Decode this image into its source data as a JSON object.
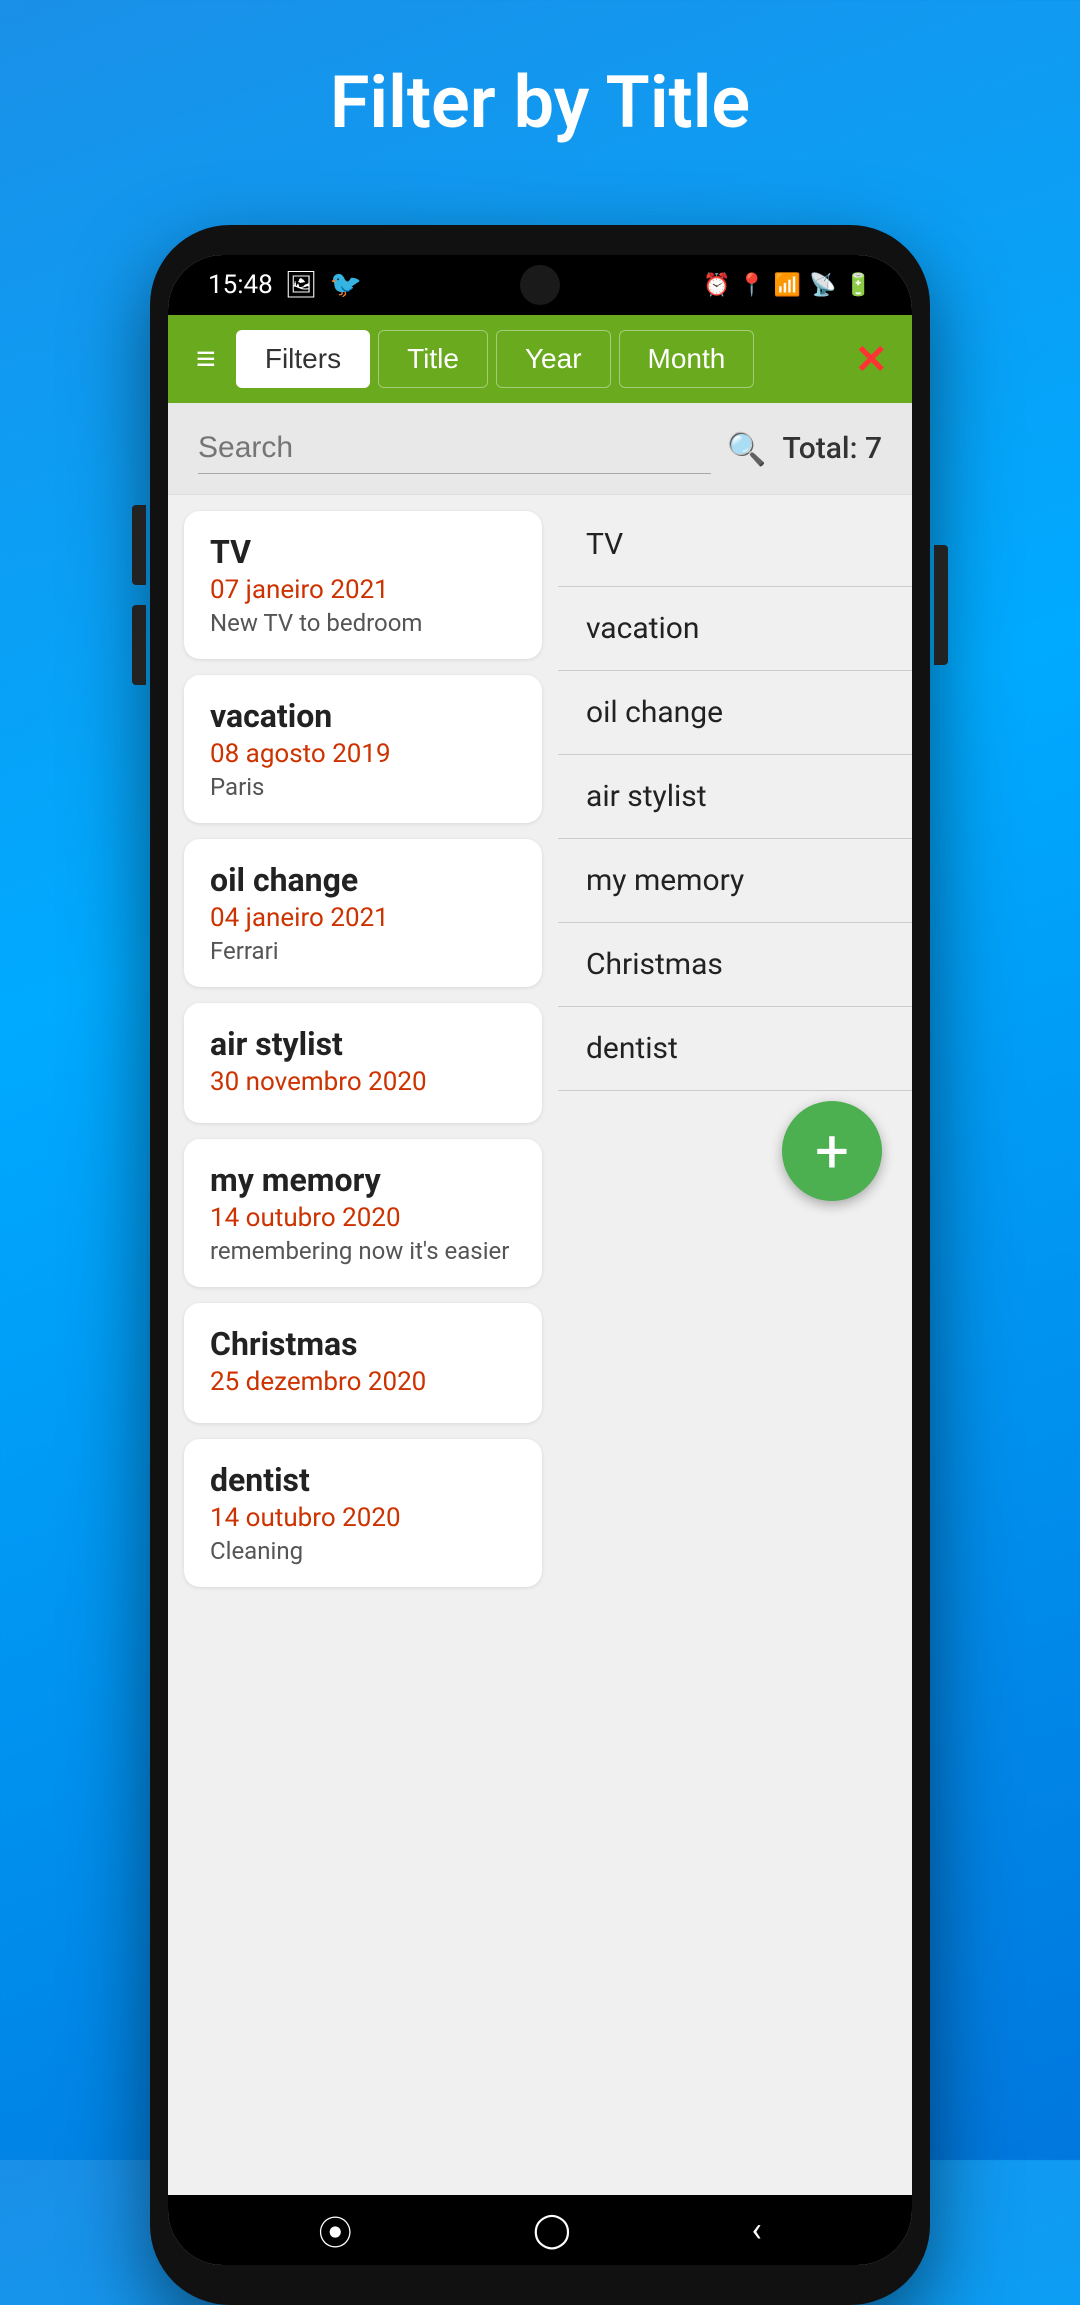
{
  "page": {
    "title": "Filter by Title"
  },
  "status_bar": {
    "time": "15:48",
    "icons_left": [
      "photo",
      "twitter"
    ],
    "icons_right": [
      "alarm",
      "location",
      "wifi",
      "signal",
      "battery"
    ]
  },
  "toolbar": {
    "menu_icon": "≡",
    "buttons": [
      {
        "label": "Filters",
        "active": true
      },
      {
        "label": "Title",
        "active": false
      },
      {
        "label": "Year",
        "active": false
      },
      {
        "label": "Month",
        "active": false
      }
    ],
    "close_icon": "✕"
  },
  "search_bar": {
    "placeholder": "Search",
    "total_label": "Total:  7"
  },
  "cards": [
    {
      "title": "TV",
      "date": "07 janeiro 2021",
      "description": "New TV to bedroom"
    },
    {
      "title": "vacation",
      "date": "08 agosto 2019",
      "description": "Paris"
    },
    {
      "title": "oil change",
      "date": "04 janeiro 2021",
      "description": "Ferrari"
    },
    {
      "title": "air stylist",
      "date": "30 novembro 2020",
      "description": ""
    },
    {
      "title": "my memory",
      "date": "14 outubro 2020",
      "description": "remembering now it's easier"
    },
    {
      "title": "Christmas",
      "date": "25 dezembro 2020",
      "description": ""
    },
    {
      "title": "dentist",
      "date": "14 outubro 2020",
      "description": "Cleaning"
    }
  ],
  "list_items": [
    "TV",
    "vacation",
    "oil change",
    "air stylist",
    "my memory",
    "Christmas",
    "dentist"
  ],
  "fab": {
    "icon": "+"
  }
}
